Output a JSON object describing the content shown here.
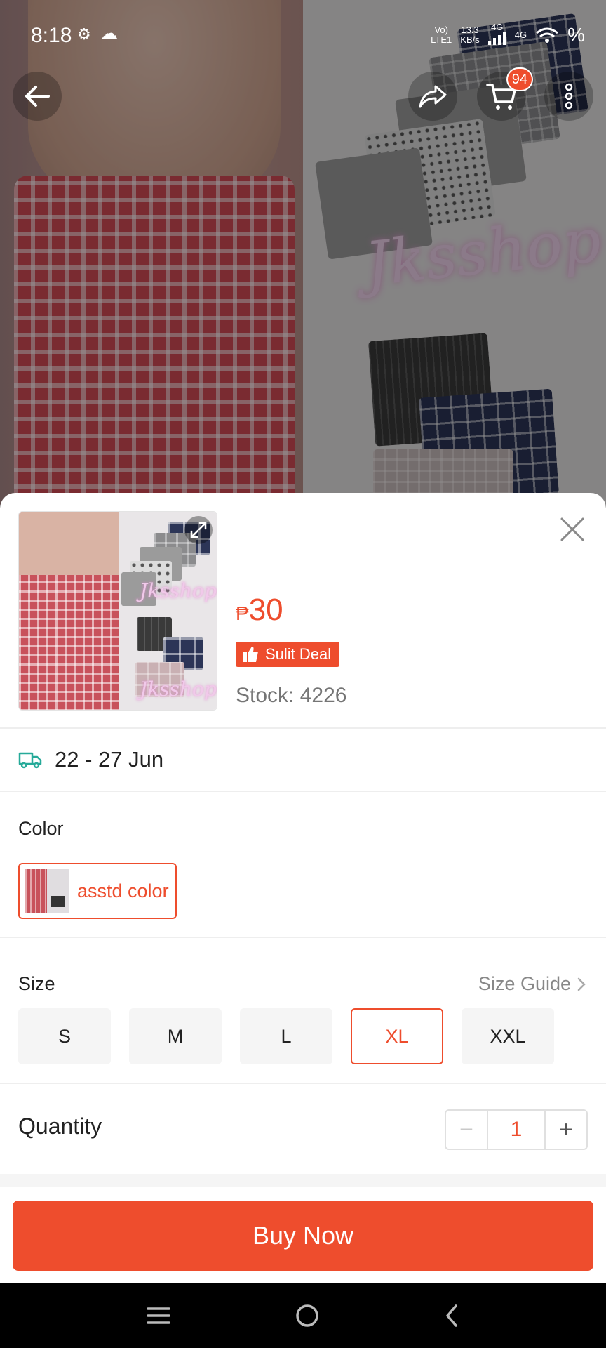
{
  "status_bar": {
    "time": "8:18",
    "network_label_1": "Vo)",
    "network_label_2": "LTE1",
    "speed_value": "13.3",
    "speed_unit": "KB/s",
    "signal_1": "4G",
    "signal_2": "4G",
    "battery": "%"
  },
  "hero": {
    "watermark": "Jksshop"
  },
  "top_nav": {
    "cart_badge": "94"
  },
  "sheet": {
    "thumbnail_watermark": "Jksshop",
    "price_currency": "₱",
    "price_value": "30",
    "deal_label": "Sulit Deal",
    "stock_text": "Stock: 4226",
    "delivery_text": "22 - 27 Jun",
    "color_label": "Color",
    "color_options": [
      {
        "label": "asstd color",
        "selected": true
      }
    ],
    "size_label": "Size",
    "size_guide_label": "Size Guide",
    "sizes": [
      {
        "label": "S",
        "selected": false
      },
      {
        "label": "M",
        "selected": false
      },
      {
        "label": "L",
        "selected": false
      },
      {
        "label": "XL",
        "selected": true
      },
      {
        "label": "XXL",
        "selected": false
      }
    ],
    "quantity_label": "Quantity",
    "quantity_value": "1",
    "minus_label": "−",
    "plus_label": "+",
    "buy_button_label": "Buy Now"
  },
  "colors": {
    "accent": "#ee4d2d",
    "delivery_icon": "#26aa99"
  },
  "icons": {
    "back": "arrow-left-icon",
    "share": "share-icon",
    "cart": "cart-icon",
    "more": "more-vertical-icon",
    "expand": "expand-icon",
    "close": "close-icon",
    "delivery": "truck-icon",
    "deal": "thumbs-up-icon",
    "size_guide": "chevron-right-icon",
    "sys_menu": "menu-icon",
    "sys_home": "home-circle-icon",
    "sys_back": "chevron-left-icon"
  }
}
